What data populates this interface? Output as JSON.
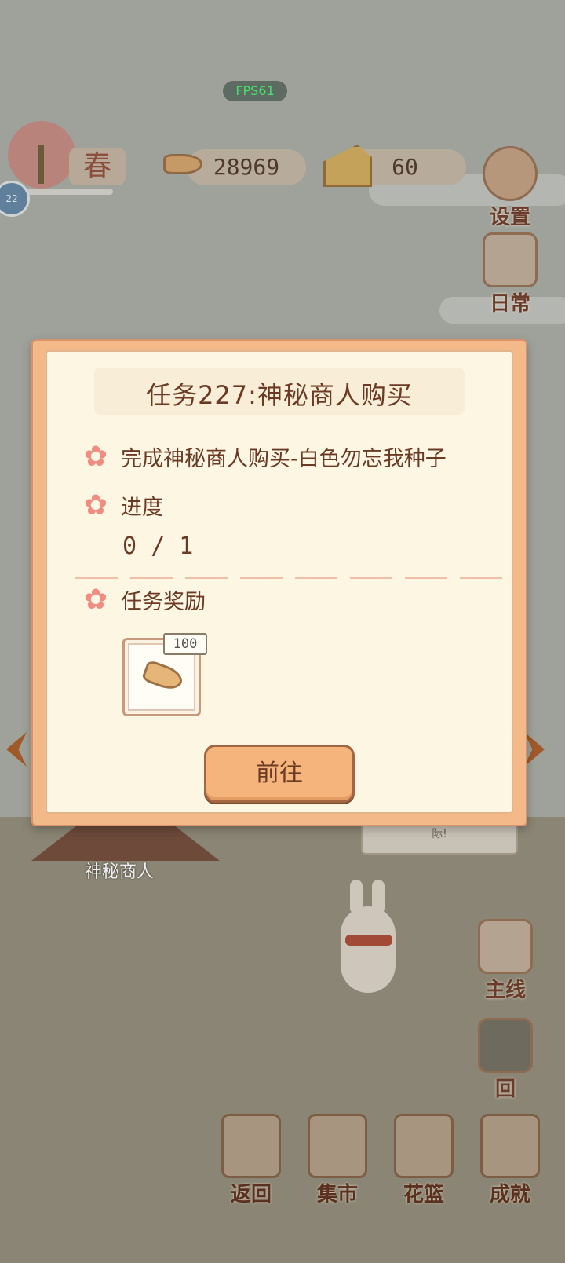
{
  "hud": {
    "fps": "FPS61",
    "season_label": "春",
    "level": "22",
    "fish_count": "28969",
    "cheese_count": "60"
  },
  "side_menu": {
    "settings": "设置",
    "daily": "日常",
    "mainline": "主线",
    "return_home": "回"
  },
  "world": {
    "merchant_label": "神秘商人",
    "speech_partial": "际!"
  },
  "bottom_bar": {
    "back": "返回",
    "market": "集市",
    "basket": "花篮",
    "achievement": "成就"
  },
  "quest_modal": {
    "title": "任务227:神秘商人购买",
    "description": "完成神秘商人购买-白色勿忘我种子",
    "progress_label": "进度",
    "progress_value": "0 / 1",
    "progress": {
      "current": 0,
      "total": 1
    },
    "reward_label": "任务奖励",
    "reward_amount": "100",
    "reward_icon": "fishbone-icon",
    "go_button": "前往"
  },
  "colors": {
    "modal_frame": "#f3b988",
    "modal_panel": "#fdf6e3",
    "text_brown": "#6b3a24",
    "flower_pink": "#f08d80",
    "button_orange": "#f5b47c"
  }
}
